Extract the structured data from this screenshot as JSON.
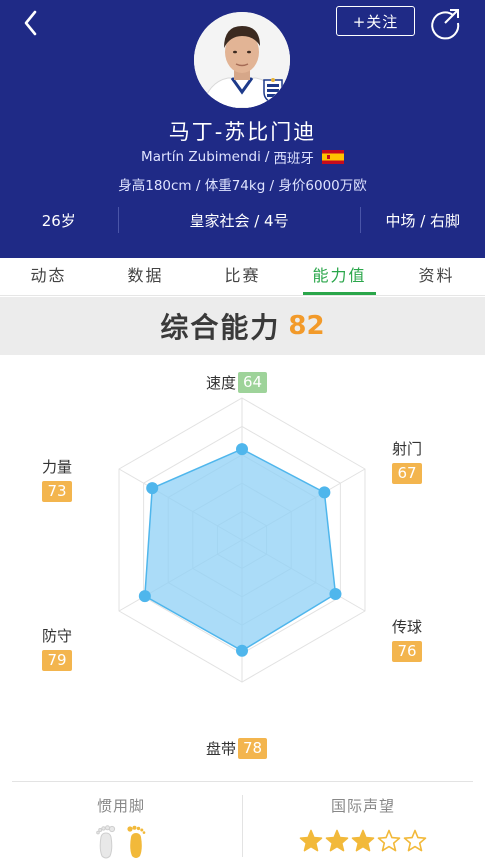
{
  "header": {
    "follow_label": "+关注",
    "name": "马丁-苏比门迪",
    "name_latin": "Martín Zubimendi",
    "nationality_sep": "/",
    "nationality": "西班牙",
    "body_info": "身高180cm / 体重74kg / 身价6000万欧",
    "age": "26岁",
    "club_number": "皇家社会 / 4号",
    "position_foot": "中场 / 右脚"
  },
  "tabs": [
    {
      "label": "动态"
    },
    {
      "label": "数据"
    },
    {
      "label": "比赛"
    },
    {
      "label": "能力值"
    },
    {
      "label": "资料"
    }
  ],
  "overall": {
    "label": "综合能力",
    "value": "82"
  },
  "abilities": [
    {
      "name": "速度",
      "value": "64",
      "color": "#9ed39a"
    },
    {
      "name": "射门",
      "value": "67",
      "color": "#f3b54e"
    },
    {
      "name": "传球",
      "value": "76",
      "color": "#f3b54e"
    },
    {
      "name": "盘带",
      "value": "78",
      "color": "#f3b54e"
    },
    {
      "name": "防守",
      "value": "79",
      "color": "#f3b54e"
    },
    {
      "name": "力量",
      "value": "73",
      "color": "#f3b54e"
    }
  ],
  "bottom": {
    "foot_title": "惯用脚",
    "foot_preferred": "right",
    "reputation_title": "国际声望",
    "reputation_stars": 3,
    "reputation_max": 5
  },
  "colors": {
    "header_bg": "#1f2a86",
    "accent_green": "#2aa64a",
    "badge_orange": "#f3b54e",
    "badge_green": "#9ed39a",
    "radar_fill": "#8fd0f5",
    "star_gold": "#f2b93a"
  },
  "icons": {
    "back": "back-arrow-icon",
    "share": "share-icon",
    "club_badge": "real-sociedad-crest-icon",
    "flag": "spain-flag-icon",
    "foot_left": "left-foot-icon",
    "foot_right": "right-foot-icon",
    "star": "star-icon"
  }
}
